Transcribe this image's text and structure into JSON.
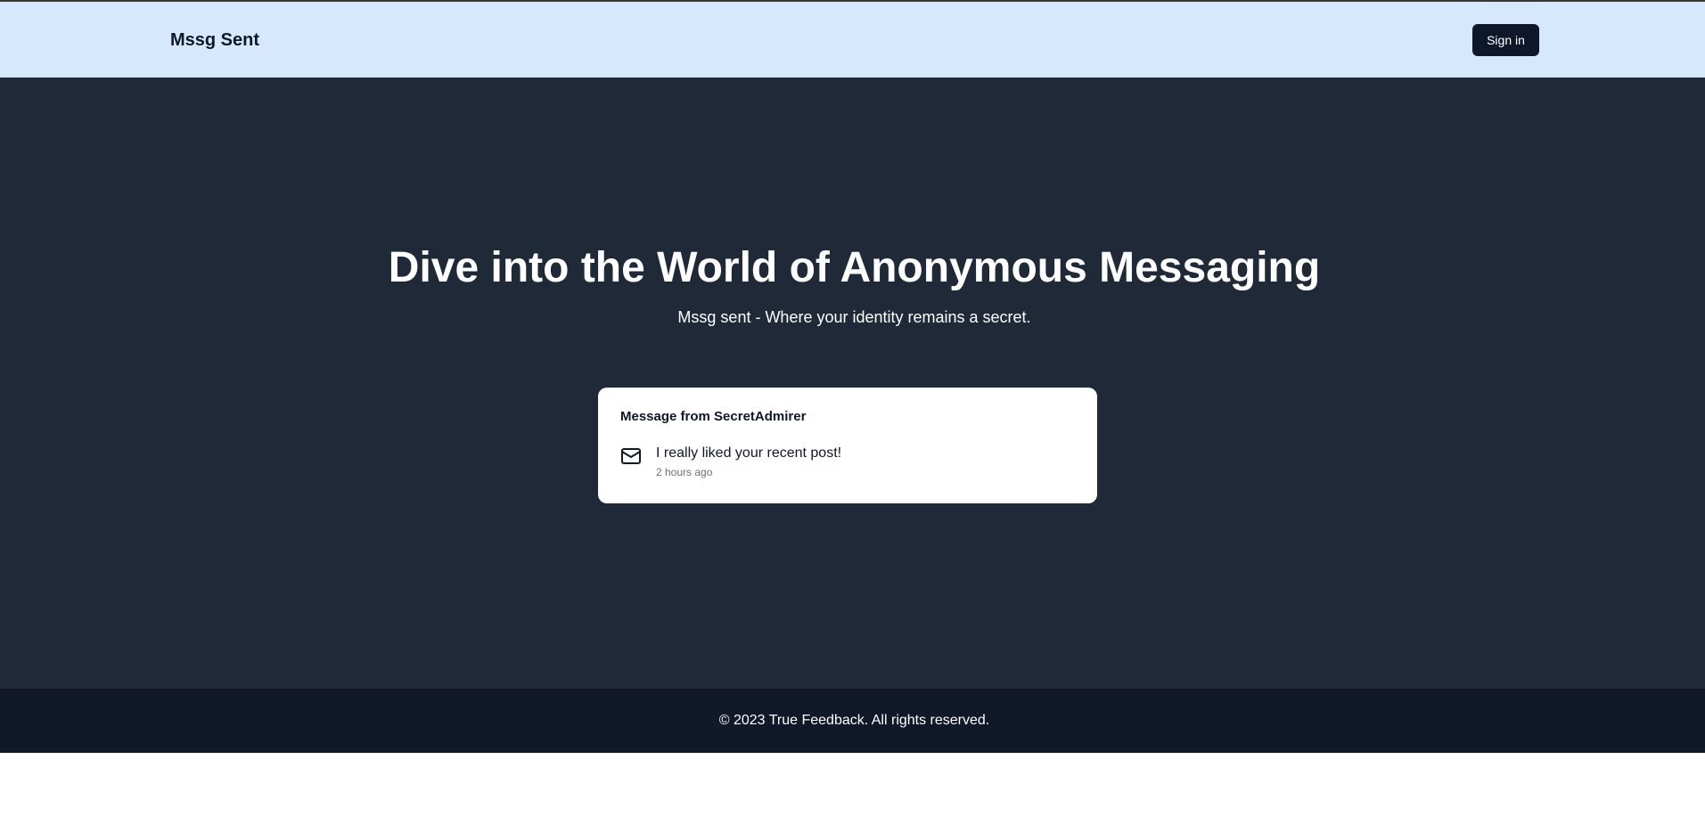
{
  "header": {
    "brand": "Mssg Sent",
    "signin_label": "Sign in"
  },
  "hero": {
    "title": "Dive into the World of Anonymous Messaging",
    "subtitle": "Mssg sent - Where your identity remains a secret."
  },
  "message_card": {
    "title": "Message from SecretAdmirer",
    "icon": "mail-icon",
    "text": "I really liked your recent post!",
    "timestamp": "2 hours ago"
  },
  "footer": {
    "text": "© 2023 True Feedback. All rights reserved."
  },
  "colors": {
    "navbar_bg": "#d6e9fc",
    "hero_bg": "#1f2937",
    "footer_bg": "#111827",
    "button_bg": "#0f172a"
  }
}
